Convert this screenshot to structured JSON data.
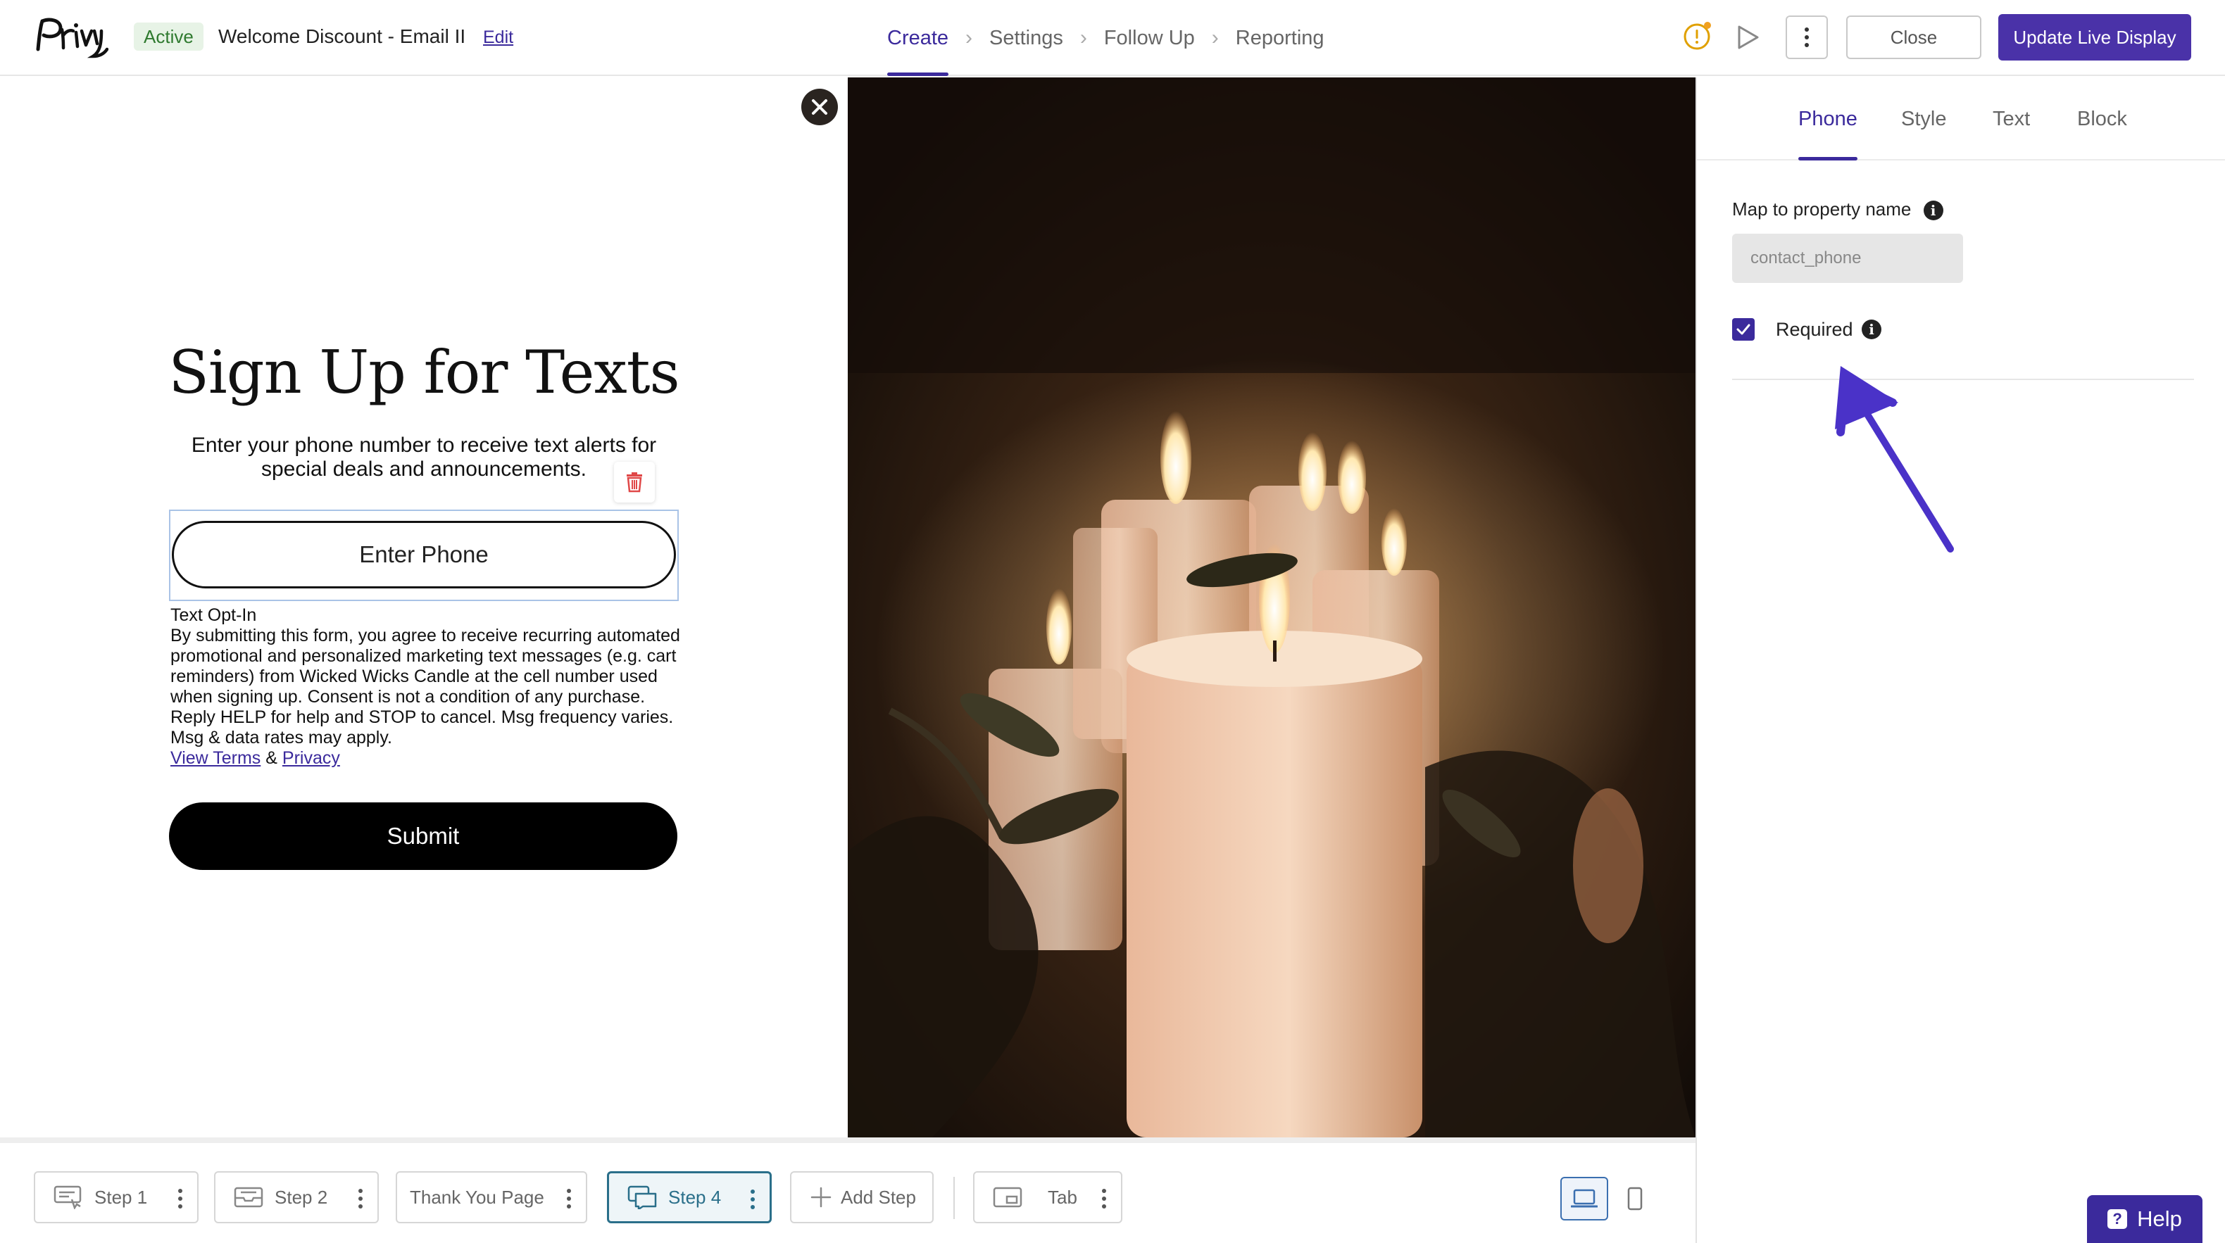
{
  "header": {
    "logo_alt": "Privy",
    "status": "Active",
    "title": "Welcome Discount - Email II",
    "edit_label": "Edit",
    "nav": [
      {
        "label": "Create",
        "active": true
      },
      {
        "label": "Settings",
        "active": false
      },
      {
        "label": "Follow Up",
        "active": false
      },
      {
        "label": "Reporting",
        "active": false
      }
    ],
    "close_label": "Close",
    "update_label": "Update Live Display",
    "icons": [
      "warning-icon",
      "play-icon",
      "kebab-icon"
    ],
    "colors": {
      "accent": "#3b2a9c",
      "warning": "#e0a000",
      "active_badge_bg": "#e7f3e6"
    }
  },
  "form": {
    "heading": "Sign Up for Texts",
    "subheading": "Enter your phone number to receive text alerts for special deals and announcements.",
    "phone_placeholder": "Enter Phone",
    "optin_title": "Text Opt-In",
    "optin_body": "By submitting this form, you agree to receive recurring automated promotional and personalized marketing text messages (e.g. cart reminders) from Wicked Wicks Candle at the cell number used when signing up. Consent is not a condition of any purchase. Reply HELP for help and STOP to cancel. Msg frequency varies. Msg & data rates may apply.",
    "terms_link": "View Terms",
    "amp": "&",
    "privacy_link": "Privacy",
    "submit_label": "Submit"
  },
  "properties": {
    "tabs": [
      {
        "label": "Phone",
        "active": true
      },
      {
        "label": "Style",
        "active": false
      },
      {
        "label": "Text",
        "active": false
      },
      {
        "label": "Block",
        "active": false
      }
    ],
    "map_label": "Map to property name",
    "map_value": "contact_phone",
    "required_label": "Required",
    "required_checked": true
  },
  "stepbar": {
    "steps": [
      {
        "label": "Step 1",
        "icon": "form-icon",
        "active": false
      },
      {
        "label": "Step 2",
        "icon": "inbox-icon",
        "active": false
      },
      {
        "label": "Thank You Page",
        "icon": "",
        "active": false
      },
      {
        "label": "Step 4",
        "icon": "chat-icon",
        "active": true
      }
    ],
    "add_step_label": "Add Step",
    "tab_label": "Tab",
    "device_modes": [
      "desktop-icon",
      "mobile-icon"
    ]
  },
  "help_label": "Help"
}
